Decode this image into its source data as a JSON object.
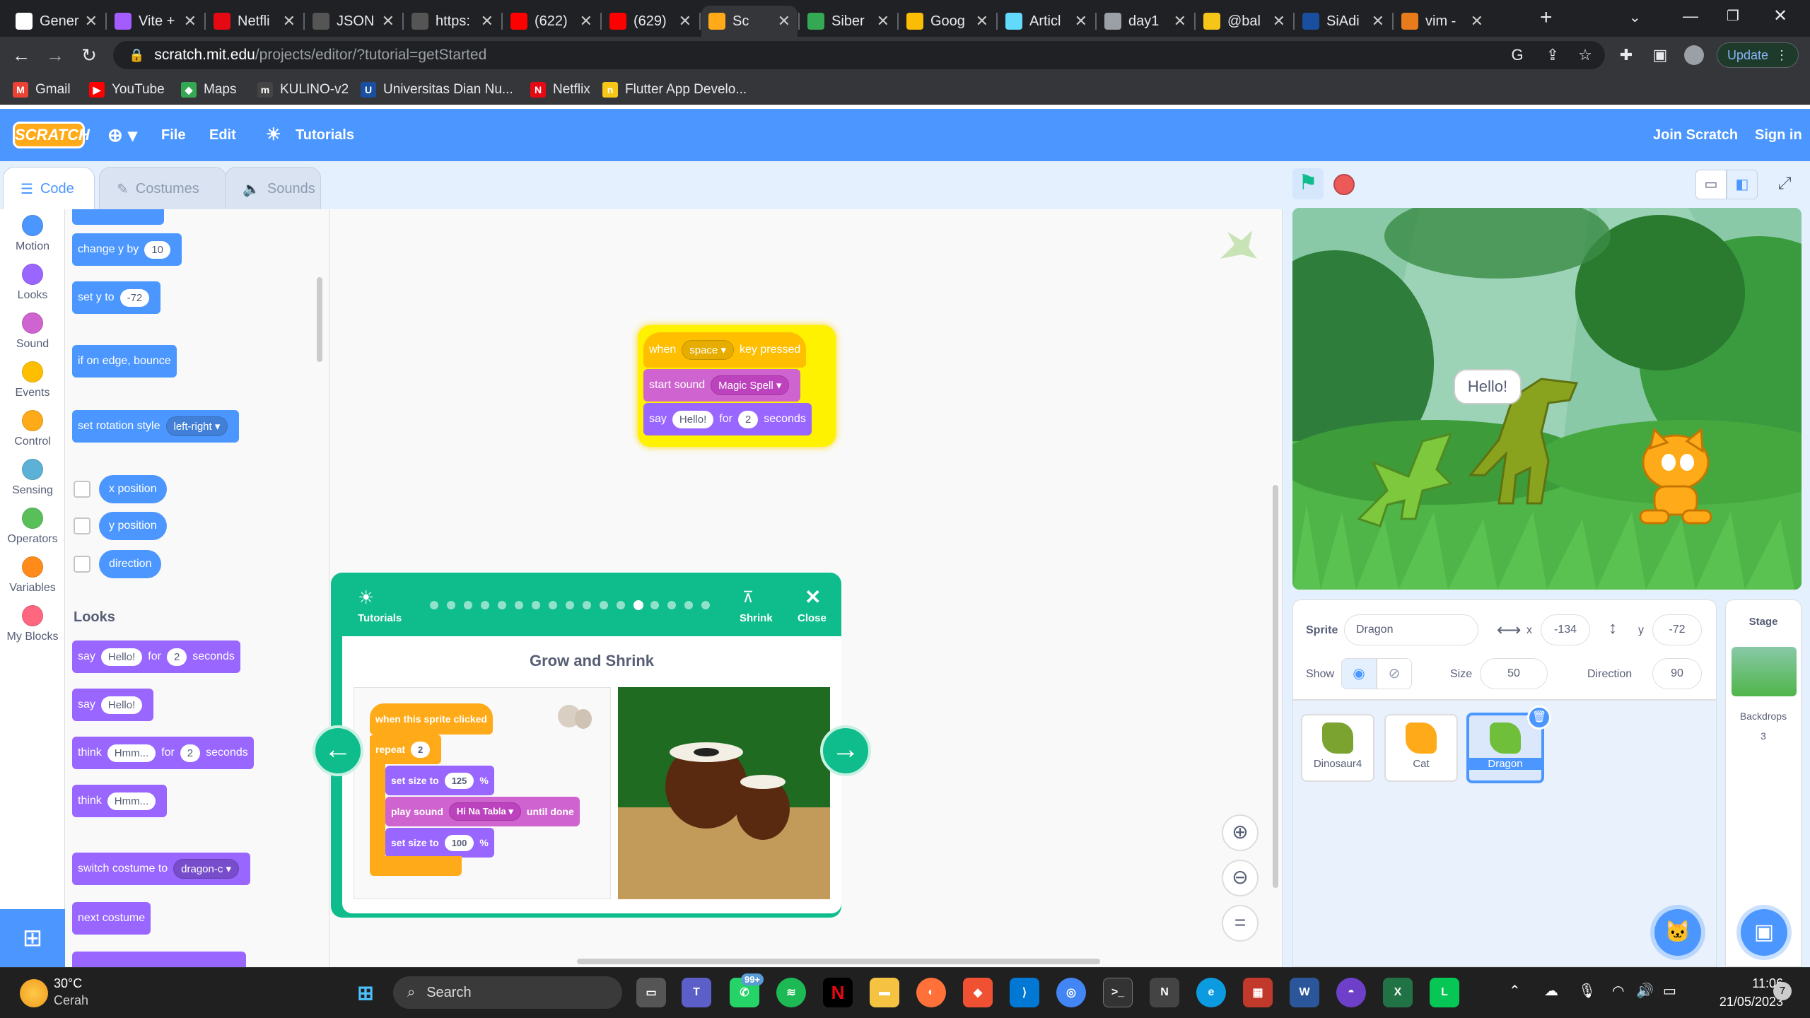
{
  "browser": {
    "tabs": [
      {
        "title": "Gener",
        "icon": "github-icon",
        "color": "#ffffff"
      },
      {
        "title": "Vite +",
        "icon": "vite-icon",
        "color": "#a45cff"
      },
      {
        "title": "Netfli",
        "icon": "netflix-icon",
        "color": "#e50914"
      },
      {
        "title": "JSON",
        "icon": "json-icon",
        "color": "#555555"
      },
      {
        "title": "https:",
        "icon": "page-icon",
        "color": "#555555"
      },
      {
        "title": "(622)",
        "icon": "youtube-icon",
        "color": "#ff0000"
      },
      {
        "title": "(629)",
        "icon": "youtube-icon",
        "color": "#ff0000"
      },
      {
        "title": "Sc",
        "icon": "scratch-icon",
        "color": "#ffab19",
        "active": true
      },
      {
        "title": "Siber",
        "icon": "drive-icon",
        "color": "#34a853"
      },
      {
        "title": "Goog",
        "icon": "drive-icon",
        "color": "#fbbc04"
      },
      {
        "title": "Articl",
        "icon": "react-icon",
        "color": "#61dafb"
      },
      {
        "title": "day1",
        "icon": "globe-icon",
        "color": "#9aa0a6"
      },
      {
        "title": "@bal",
        "icon": "bolt-icon",
        "color": "#f5c518"
      },
      {
        "title": "SiAdi",
        "icon": "siadin-icon",
        "color": "#1a4fa0"
      },
      {
        "title": "vim -",
        "icon": "vim-icon",
        "color": "#e87b1c"
      }
    ],
    "url_host": "scratch.mit.edu",
    "url_path": "/projects/editor/?tutorial=getStarted",
    "update_label": "Update",
    "bookmarks": [
      {
        "label": "Gmail",
        "icon": "gmail-icon",
        "color": "#ea4335",
        "glyph": "M"
      },
      {
        "label": "YouTube",
        "icon": "youtube-icon",
        "color": "#ff0000",
        "glyph": "▶"
      },
      {
        "label": "Maps",
        "icon": "maps-icon",
        "color": "#34a853",
        "glyph": "◆"
      },
      {
        "label": "KULINO-v2",
        "icon": "kulino-icon",
        "color": "#444444",
        "glyph": "m"
      },
      {
        "label": "Universitas Dian Nu...",
        "icon": "udinus-icon",
        "color": "#1a4fa0",
        "glyph": "U"
      },
      {
        "label": "Netflix",
        "icon": "netflix-icon",
        "color": "#e50914",
        "glyph": "N"
      },
      {
        "label": "Flutter App Develo...",
        "icon": "flutter-icon",
        "color": "#f5c518",
        "glyph": "n"
      }
    ]
  },
  "scratch": {
    "logo": "SCRATCH",
    "menu": {
      "file": "File",
      "edit": "Edit",
      "tutorials": "Tutorials",
      "join": "Join Scratch",
      "signin": "Sign in"
    },
    "tabs": {
      "code": "Code",
      "costumes": "Costumes",
      "sounds": "Sounds"
    },
    "categories": [
      {
        "label": "Motion",
        "color": "#4c97ff"
      },
      {
        "label": "Looks",
        "color": "#9966ff"
      },
      {
        "label": "Sound",
        "color": "#cf63cf"
      },
      {
        "label": "Events",
        "color": "#ffbf00"
      },
      {
        "label": "Control",
        "color": "#ffab19"
      },
      {
        "label": "Sensing",
        "color": "#5cb1d6"
      },
      {
        "label": "Operators",
        "color": "#59c059"
      },
      {
        "label": "Variables",
        "color": "#ff8c1a"
      },
      {
        "label": "My Blocks",
        "color": "#ff6680"
      }
    ],
    "palette": {
      "change_y": {
        "text": "change y by",
        "value": "10"
      },
      "set_y": {
        "text": "set y to",
        "value": "-72"
      },
      "bounce": "if on edge, bounce",
      "rotation": {
        "text": "set rotation style",
        "value": "left-right"
      },
      "x_position": "x position",
      "y_position": "y position",
      "direction": "direction",
      "looks_header": "Looks",
      "say_for": {
        "say": "say",
        "msg": "Hello!",
        "for": "for",
        "secs": "2",
        "seconds": "seconds"
      },
      "say": {
        "say": "say",
        "msg": "Hello!"
      },
      "think_for": {
        "think": "think",
        "msg": "Hmm...",
        "for": "for",
        "secs": "2",
        "seconds": "seconds"
      },
      "think": {
        "think": "think",
        "msg": "Hmm..."
      },
      "switch_costume": {
        "text": "switch costume to",
        "value": "dragon-c"
      },
      "next_costume": "next costume"
    },
    "script": {
      "hat": {
        "when": "when",
        "key": "space",
        "pressed": "key pressed"
      },
      "sound": {
        "text": "start sound",
        "value": "Magic Spell"
      },
      "say": {
        "say": "say",
        "msg": "Hello!",
        "for": "for",
        "secs": "2",
        "seconds": "seconds"
      }
    },
    "tutorial": {
      "tutorials_label": "Tutorials",
      "shrink_label": "Shrink",
      "close_label": "Close",
      "title": "Grow and Shrink",
      "steps_total": 17,
      "current_step": 12,
      "blocks": {
        "hat": "when this sprite clicked",
        "repeat": "repeat",
        "repeat_count": "2",
        "set_size": "set size to",
        "size_a": "125",
        "percent": "%",
        "play_sound": "play sound",
        "sound_name": "Hi Na Tabla",
        "until_done": "until done",
        "size_b": "100"
      }
    },
    "stage": {
      "speech": "Hello!"
    },
    "sprite_info": {
      "sprite_label": "Sprite",
      "sprite_name": "Dragon",
      "x_label": "x",
      "x_value": "-134",
      "y_label": "y",
      "y_value": "-72",
      "show_label": "Show",
      "size_label": "Size",
      "size_value": "50",
      "direction_label": "Direction",
      "direction_value": "90"
    },
    "sprites": [
      {
        "name": "Dinosaur4",
        "color": "#7ba330"
      },
      {
        "name": "Cat",
        "color": "#ffab19"
      },
      {
        "name": "Dragon",
        "color": "#6fbf3b",
        "selected": true
      }
    ],
    "stage_pane": {
      "label": "Stage",
      "backdrops_label": "Backdrops",
      "backdrops_count": "3"
    }
  },
  "taskbar": {
    "weather_temp": "30°C",
    "weather_desc": "Cerah",
    "search": "Search",
    "whatsapp_badge": "99+",
    "time": "11:06",
    "date": "21/05/2023",
    "notif_count": "7"
  }
}
